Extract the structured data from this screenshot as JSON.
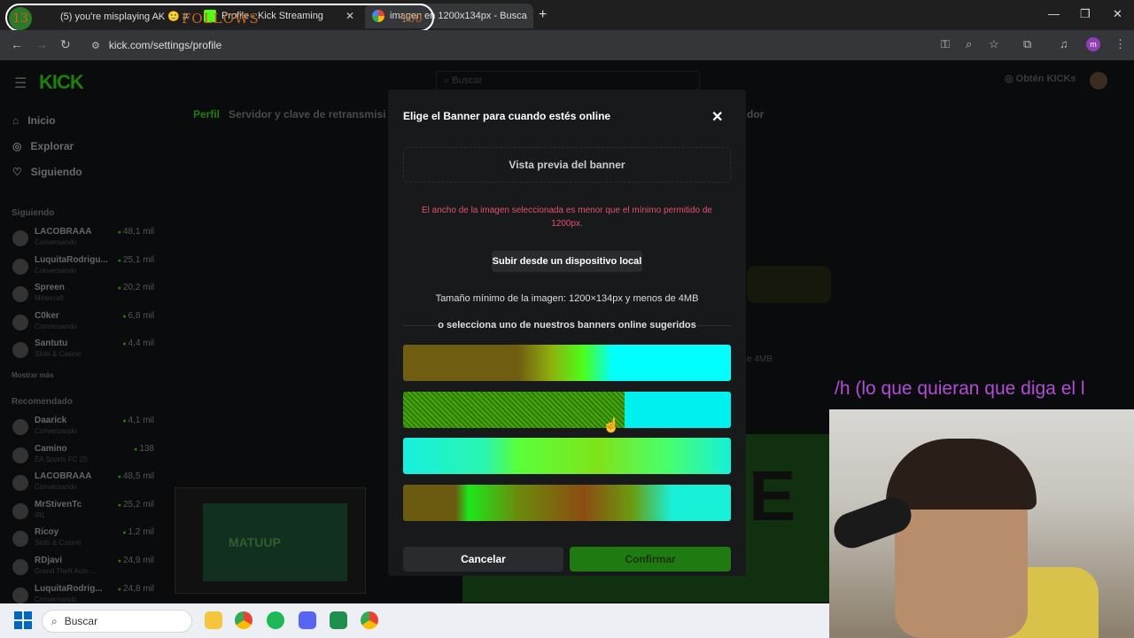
{
  "browser": {
    "tabs": [
      {
        "label": "(5) you're misplaying AK 🙂 #"
      },
      {
        "label": "Profile - Kick Streaming"
      },
      {
        "label": "imagen en 1200x134px - Busca"
      }
    ],
    "new_tab": "+",
    "url": "kick.com/settings/profile",
    "profile_initial": "m"
  },
  "stream_overlay": {
    "count": "13",
    "follows": "FOLLOWS",
    "goal": "100"
  },
  "kick": {
    "logo": "KICK",
    "search_placeholder": "Buscar",
    "get_kicks": "Obtén KICKs",
    "nav": [
      {
        "label": "Inicio"
      },
      {
        "label": "Explorar"
      },
      {
        "label": "Siguiendo"
      }
    ],
    "following_title": "Siguiendo",
    "following": [
      {
        "name": "LACOBRAAA",
        "sub": "Conversando",
        "viewers": "48,1 mil"
      },
      {
        "name": "LuquitaRodrigu...",
        "sub": "Conversando",
        "viewers": "25,1 mil"
      },
      {
        "name": "Spreen",
        "sub": "Minecraft",
        "viewers": "20,2 mil"
      },
      {
        "name": "C0ker",
        "sub": "Conversando",
        "viewers": "6,8 mil"
      },
      {
        "name": "Santutu",
        "sub": "Slots & Casino",
        "viewers": "4,4 mil"
      }
    ],
    "show_more": "Mostrar más",
    "recommended_title": "Recomendado",
    "recommended": [
      {
        "name": "Daarick",
        "sub": "Conversando",
        "viewers": "4,1 mil"
      },
      {
        "name": "Camino",
        "sub": "EA Sports FC 25",
        "viewers": "138"
      },
      {
        "name": "LACOBRAAA",
        "sub": "Conversando",
        "viewers": "48,5 mil"
      },
      {
        "name": "MrStivenTc",
        "sub": "IRL",
        "viewers": "25,2 mil"
      },
      {
        "name": "Ricoy",
        "sub": "Slots & Casino",
        "viewers": "1,2 mil"
      },
      {
        "name": "RDjavi",
        "sub": "Grand Theft Auto ...",
        "viewers": "24,9 mil"
      },
      {
        "name": "LuquitaRodrig...",
        "sub": "Conversando",
        "viewers": "24,8 mil"
      }
    ],
    "profile_tabs": [
      "Perfil",
      "Servidor y clave de retransmisi"
    ],
    "profile_tab_right": "dor",
    "bg_4mb": "e 4MB",
    "bg_big_text": "E",
    "mini_text": "MATUUP"
  },
  "modal": {
    "title": "Elige el Banner para cuando estés online",
    "close": "✕",
    "preview_label": "Vista previa del banner",
    "error": "El ancho de la imagen seleccionada es menor que el mínimo permitido de 1200px.",
    "upload_label": "Subir desde un dispositivo local",
    "min_size": "Tamaño mínimo de la imagen: 1200×134px y menos de 4MB",
    "or_select": "o selecciona uno de nuestros banners online sugeridos",
    "cancel": "Cancelar",
    "confirm": "Confirmar"
  },
  "webcam_caption": "/h (lo que quieran que diga el l",
  "taskbar": {
    "search": "Buscar"
  },
  "colors": {
    "kick_green": "#53fc18",
    "error": "#e2516e",
    "caption": "#b34dd6"
  }
}
